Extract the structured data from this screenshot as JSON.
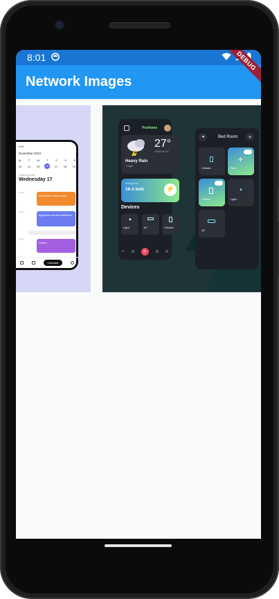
{
  "statusbar": {
    "time": "8:01",
    "debug_label": "DEBUG"
  },
  "appbar": {
    "title": "Network Images"
  },
  "image1": {
    "month": "November 2023",
    "weekdays": [
      "M",
      "T",
      "W",
      "T",
      "F",
      "S",
      "S"
    ],
    "dates": [
      "13",
      "14",
      "15",
      "16",
      "17",
      "18",
      "19"
    ],
    "subtitle": "Today 4 events",
    "day": "Wednesday 17",
    "events": [
      {
        "time": "10:00",
        "title": "Introduction to the course",
        "color": "#f28a2e"
      },
      {
        "time": "11:00",
        "title": "Algorithms and their definitions",
        "color": "#6c7cf0"
      },
      {
        "time": "14:00",
        "title": "Lecture",
        "color": "#a45ee0"
      }
    ],
    "tab_label": "Calendar"
  },
  "image2": {
    "app_name": "ProHome",
    "temperature": "27°",
    "feels_like": "Feels like 32°",
    "weather": "Heavy Rain",
    "weather_sub": "Tonight",
    "energy_label": "Energy Use",
    "energy_value": "16.4 kwh",
    "devices_label": "Devices",
    "devices": [
      "Light",
      "AC",
      "Climate"
    ],
    "room_title": "Bed Room",
    "room_tiles": [
      "Climate",
      "Fan",
      "Purifier",
      "Light",
      "AC"
    ],
    "accent_green": "#8ee88a"
  }
}
